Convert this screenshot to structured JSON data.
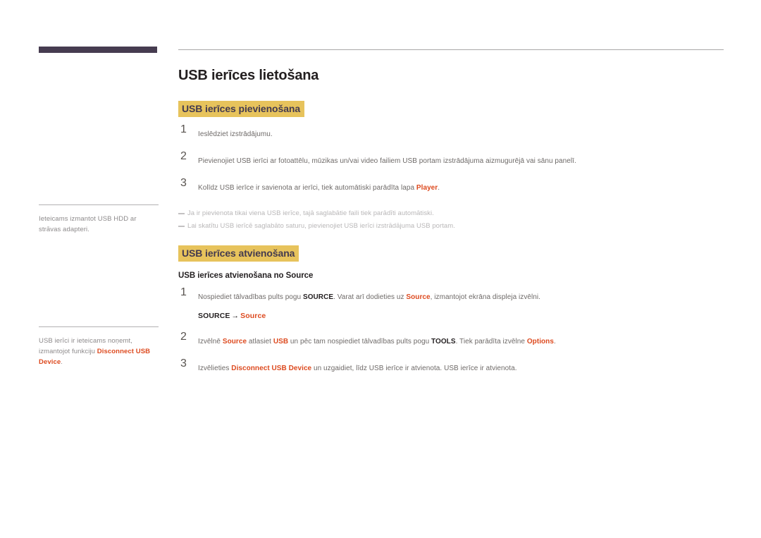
{
  "colors": {
    "header_bar": "#463c50",
    "highlight": "#e7c35c",
    "heading_text": "#433a4f",
    "accent": "#dd4a1f",
    "body_text": "#6e6a68",
    "note_text": "#b9b7b8",
    "margin_text": "#8d8a8b",
    "rule": "#a9a7a8"
  },
  "document": {
    "title": "USB ierīces lietošana"
  },
  "margin_notes": [
    {
      "id": "margin-note-hdd",
      "parts": [
        {
          "text": "Ieteicams izmantot USB HDD ar strāvas adapteri.",
          "style": "plain"
        }
      ]
    },
    {
      "id": "margin-note-disconnect",
      "parts": [
        {
          "text": "USB ierīci ir ieteicams noņemt, izmantojot funkciju ",
          "style": "plain"
        },
        {
          "text": "Disconnect USB Device",
          "style": "accent"
        },
        {
          "text": ".",
          "style": "plain"
        }
      ]
    }
  ],
  "sections": [
    {
      "id": "section-connecting",
      "heading": "USB ierīces pievienošana",
      "steps": [
        {
          "number": "1",
          "parts": [
            {
              "text": "Ieslēdziet izstrādājumu.",
              "style": "plain"
            }
          ]
        },
        {
          "number": "2",
          "parts": [
            {
              "text": "Pievienojiet USB ierīci ar fotoattēlu, mūzikas un/vai video failiem USB portam izstrādājuma aizmugurējā vai sānu panelī.",
              "style": "plain"
            }
          ]
        },
        {
          "number": "3",
          "parts": [
            {
              "text": "Kolīdz USB ierīce ir savienota ar ierīci, tiek automātiski parādīta lapa ",
              "style": "plain"
            },
            {
              "text": "Player",
              "style": "accent"
            },
            {
              "text": ".",
              "style": "plain"
            }
          ]
        }
      ],
      "notes": [
        {
          "parts": [
            {
              "text": "Ja ir pievienota tikai viena USB ierīce, tajā saglabātie faili tiek parādīti automātiski.",
              "style": "plain"
            }
          ]
        },
        {
          "parts": [
            {
              "text": "Lai skatītu USB ierīcē saglabāto saturu, pievienojiet USB ierīci izstrādājuma USB portam.",
              "style": "plain"
            }
          ]
        }
      ]
    },
    {
      "id": "section-removing",
      "heading": "USB ierīces atvienošana",
      "subheading": "USB ierīces atvienošana no Source",
      "steps": [
        {
          "number": "1",
          "parts": [
            {
              "text": "Nospiediet tālvadības pults pogu ",
              "style": "plain"
            },
            {
              "text": "SOURCE",
              "style": "strong"
            },
            {
              "text": ". Varat arī dodieties uz ",
              "style": "plain"
            },
            {
              "text": "Source",
              "style": "accent"
            },
            {
              "text": ", izmantojot ekrāna displeja izvēlni.",
              "style": "plain"
            }
          ],
          "path": [
            {
              "text": "SOURCE",
              "style": "strong"
            },
            {
              "text": "→",
              "style": "arrow"
            },
            {
              "text": "Source",
              "style": "accent"
            }
          ]
        },
        {
          "number": "2",
          "parts": [
            {
              "text": "Izvēlnē ",
              "style": "plain"
            },
            {
              "text": "Source",
              "style": "accent"
            },
            {
              "text": " atlasiet ",
              "style": "plain"
            },
            {
              "text": "USB",
              "style": "accent"
            },
            {
              "text": " un pēc tam nospiediet tālvadības pults pogu ",
              "style": "plain"
            },
            {
              "text": "TOOLS",
              "style": "strong"
            },
            {
              "text": ". Tiek parādīta izvēlne ",
              "style": "plain"
            },
            {
              "text": "Options",
              "style": "accent"
            },
            {
              "text": ".",
              "style": "plain"
            }
          ]
        },
        {
          "number": "3",
          "parts": [
            {
              "text": "Izvēlieties ",
              "style": "plain"
            },
            {
              "text": "Disconnect USB Device",
              "style": "accent"
            },
            {
              "text": " un uzgaidiet, līdz USB ierīce ir atvienota. USB ierīce ir atvienota.",
              "style": "plain"
            }
          ]
        }
      ]
    }
  ]
}
